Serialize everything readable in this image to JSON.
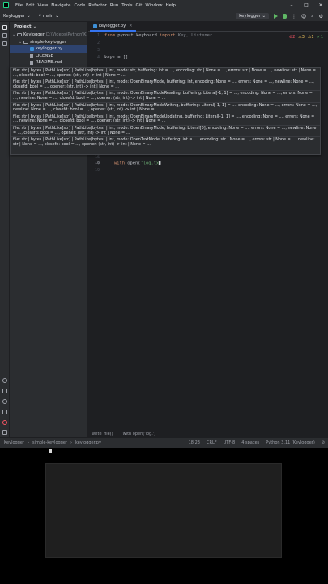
{
  "menu": [
    "File",
    "Edit",
    "View",
    "Navigate",
    "Code",
    "Refactor",
    "Run",
    "Tools",
    "Git",
    "Window",
    "Help"
  ],
  "toolbar": {
    "project": "Keylogger",
    "branch": "main",
    "run_config": "keylogger"
  },
  "project_panel": {
    "title": "Project",
    "root_name": "Keylogger",
    "root_path": "D:\\Videos\\Python\\K",
    "folder": "simple-keylogger",
    "files": [
      "keylogger.py",
      "LICENSE",
      "README.md"
    ]
  },
  "editor": {
    "tab": "keylogger.py",
    "line1_kw1": "from",
    "line1_mid": " pynput.keyboard ",
    "line1_kw2": "import",
    "line1_rest": " Key, Listener",
    "line4": "keys = []",
    "line18_kw": "with",
    "line18_a": " open(",
    "line18_str": "'log.tx",
    "line18_end": ")",
    "line_numbers": [
      "1",
      "2",
      "3",
      "4",
      "16",
      "17",
      "18",
      "19"
    ],
    "inspections": {
      "errors": "2",
      "warnings": "3",
      "weak": "1",
      "ok": "1"
    }
  },
  "signatures": [
    "file: str | bytes | PathLike[str] | PathLike[bytes] | int, mode: str, buffering: int = ..., encoding: str | None = ..., errors: str | None = ..., newline: str | None = ..., closefd: bool = ..., opener: (str, int) -> int | None = ...",
    "file: str | bytes | PathLike[str] | PathLike[bytes] | int, mode: OpenBinaryMode, buffering: int, encoding: None = ..., errors: None = ..., newline: None = ..., closefd: bool = ..., opener: (str, int) -> int | None = ...",
    "file: str | bytes | PathLike[str] | PathLike[bytes] | int, mode: OpenBinaryModeReading, buffering: Literal[-1, 1] = ..., encoding: None = ..., errors: None = ..., newline: None = ..., closefd: bool = ..., opener: (str, int) -> int | None = ...",
    "file: str | bytes | PathLike[str] | PathLike[bytes] | int, mode: OpenBinaryModeWriting, buffering: Literal[-1, 1] = ..., encoding: None = ..., errors: None = ..., newline: None = ..., closefd: bool = ..., opener: (str, int) -> int | None = ...",
    "file: str | bytes | PathLike[str] | PathLike[bytes] | int, mode: OpenBinaryModeUpdating, buffering: Literal[-1, 1] = ..., encoding: None = ..., errors: None = ..., newline: None = ..., closefd: bool = ..., opener: (str, int) -> int | None = ...",
    "file: str | bytes | PathLike[str] | PathLike[bytes] | int, mode: OpenBinaryMode, buffering: Literal[0], encoding: None = ..., errors: None = ..., newline: None = ..., closefd: bool = ..., opener: (str, int) -> int | None = ...",
    "file: str | bytes | PathLike[str] | PathLike[bytes] | int, mode: OpenTextMode, buffering: int = ..., encoding: str | None = ..., errors: str | None = ..., newline: str | None = ..., closefd: bool = ..., opener: (str, int) -> int | None = ..."
  ],
  "breadcrumbs": {
    "fn": "write_file()",
    "stmt": "with open('log.')"
  },
  "status": {
    "crumbs": [
      "Keylogger",
      "simple-keylogger",
      "keylogger.py"
    ],
    "position": "18:23",
    "line_ending": "CRLF",
    "encoding": "UTF-8",
    "indent": "4 spaces",
    "interpreter": "Python 3.11 (Keylogger)"
  },
  "icons": [
    "app-logo-icon",
    "folder-icon",
    "file-icon",
    "python-file-icon",
    "play-icon",
    "debug-icon",
    "close-icon"
  ],
  "colors": {
    "accent": "#3574f0",
    "keyword": "#cf8e6d",
    "string": "#6aab73",
    "error": "#f75464",
    "warning": "#f2c55c",
    "run": "#5fb865"
  }
}
